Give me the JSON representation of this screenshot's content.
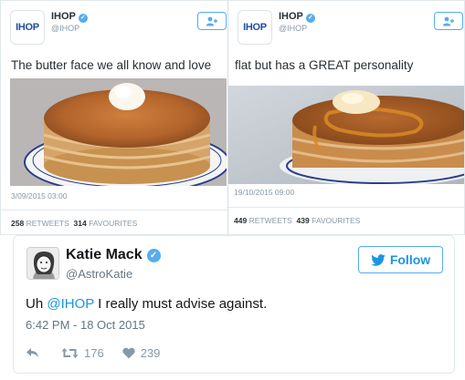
{
  "left_tweet": {
    "logo_text": "IHOP",
    "name": "IHOP",
    "handle": "@IHOP",
    "text": "The butter face we all know and love",
    "date": "3/09/2015 03:00",
    "retweets": "258",
    "retweets_label": "RETWEETS",
    "favourites": "314",
    "favourites_label": "FAVOURITES"
  },
  "right_tweet": {
    "logo_text": "IHOP",
    "name": "IHOP",
    "handle": "@IHOP",
    "text": "flat but has a GREAT personality",
    "date": "19/10/2015 09:00",
    "retweets": "449",
    "retweets_label": "RETWEETS",
    "favourites": "439",
    "favourites_label": "FAVOURITES"
  },
  "main_tweet": {
    "name": "Katie Mack",
    "handle": "@AstroKatie",
    "follow_label": "Follow",
    "text_before": "Uh ",
    "mention": "@IHOP",
    "text_after": " I really must advise against.",
    "date": "6:42 PM - 18 Oct 2015",
    "retweets": "176",
    "likes": "239"
  },
  "icons": {
    "verified": "verified-badge-icon",
    "follow": "add-user-icon",
    "reply": "reply-icon",
    "retweet": "retweet-icon",
    "like": "heart-icon",
    "twitter": "twitter-bird-icon"
  },
  "colors": {
    "accent": "#55acee",
    "link": "#1b95e0",
    "muted": "#8899a6",
    "ihop_blue": "#1f4f9c",
    "ihop_red": "#d6282f"
  }
}
